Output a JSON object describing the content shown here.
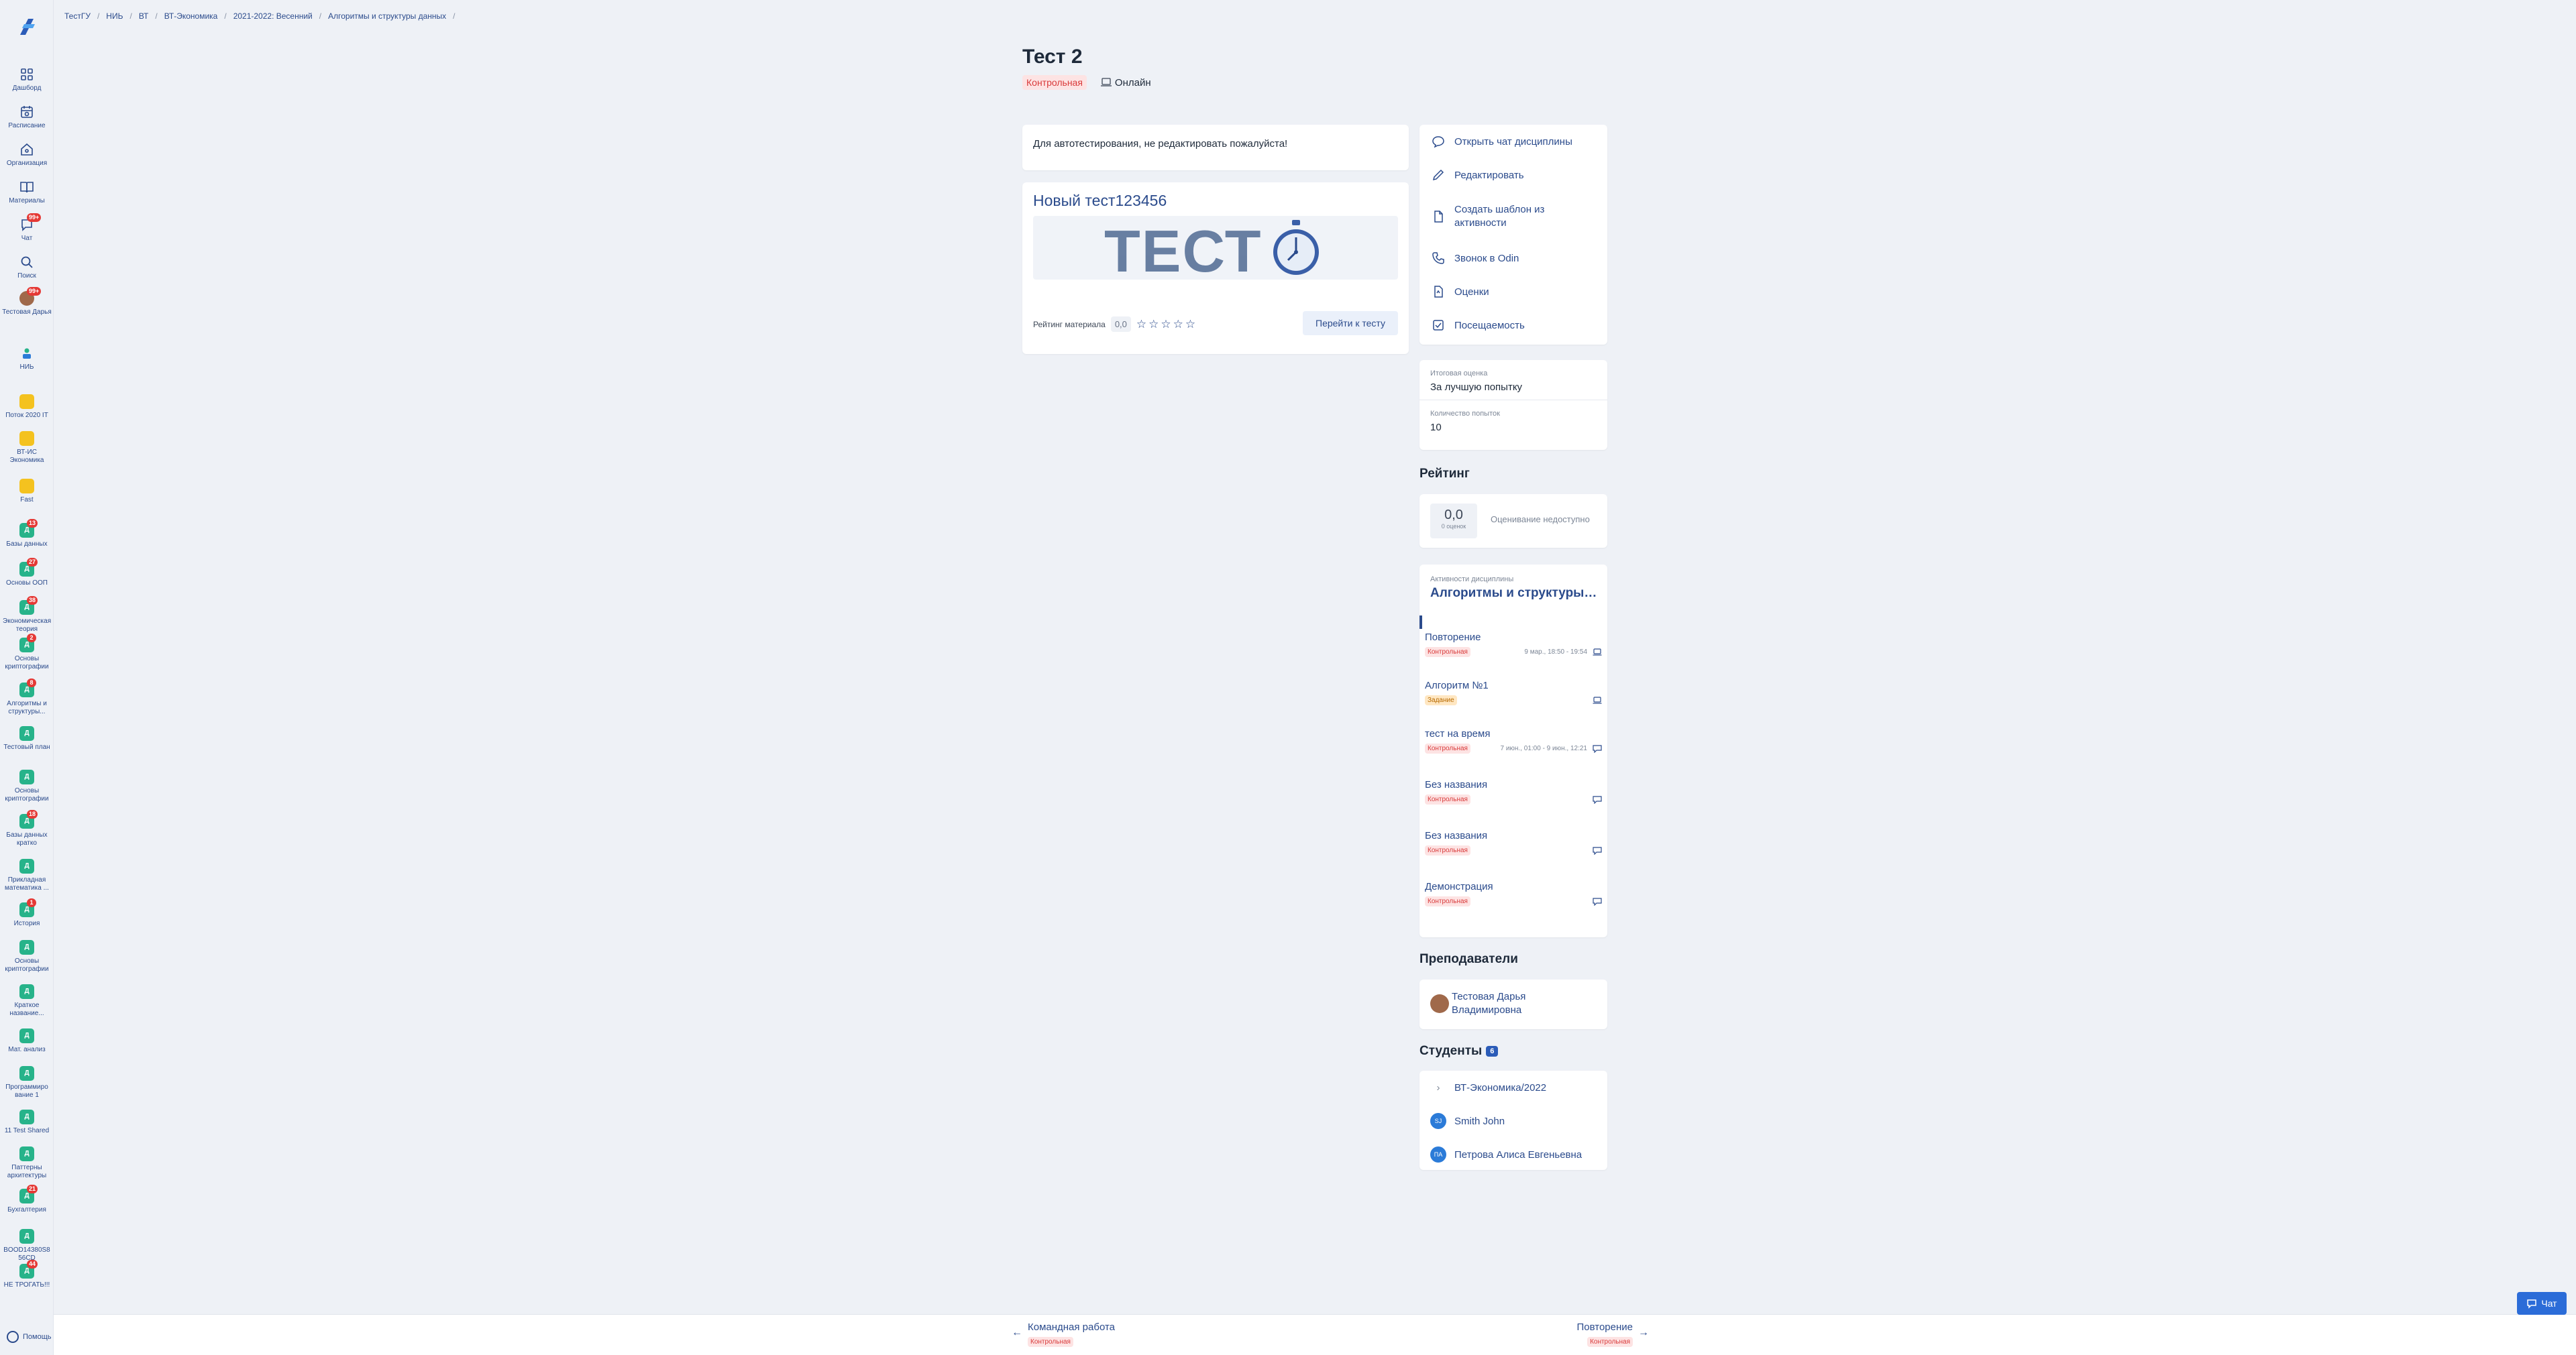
{
  "breadcrumbs": [
    "ТестГУ",
    "НИЬ",
    "ВТ",
    "ВТ-Экономика",
    "2021-2022: Весенний",
    "Алгоритмы и структуры данных"
  ],
  "sidebar": {
    "dashboard": "Дашборд",
    "schedule": "Расписание",
    "organization": "Организация",
    "materials": "Материалы",
    "chat": "Чат",
    "chat_badge": "99+",
    "search": "Поиск",
    "user": "Тестовая Дарья",
    "user_badge": "99+",
    "nii": "НИЬ",
    "groups": [
      {
        "label": "Поток 2020 IT",
        "badge": ""
      },
      {
        "label": "ВТ-ИС Экономика",
        "badge": ""
      },
      {
        "label": "Fast",
        "badge": ""
      },
      {
        "label": "Базы данных",
        "badge": "13"
      },
      {
        "label": "Основы ООП",
        "badge": "27"
      },
      {
        "label": "Экономическая теория",
        "badge": "38"
      },
      {
        "label": "Основы криптографии",
        "badge": "2"
      },
      {
        "label": "Алгоритмы и структуры...",
        "badge": "8"
      },
      {
        "label": "Тестовый план",
        "badge": ""
      },
      {
        "label": "Основы криптографии",
        "badge": ""
      },
      {
        "label": "Базы данных кратко",
        "badge": "18"
      },
      {
        "label": "Прикладная математика ...",
        "badge": ""
      },
      {
        "label": "История",
        "badge": "1"
      },
      {
        "label": "Основы криптографии",
        "badge": ""
      },
      {
        "label": "Краткое название...",
        "badge": ""
      },
      {
        "label": "Мат. анализ",
        "badge": ""
      },
      {
        "label": "Программиро вание 1",
        "badge": ""
      },
      {
        "label": "11 Test Shared",
        "badge": ""
      },
      {
        "label": "Паттерны архитектуры",
        "badge": ""
      },
      {
        "label": "Бухгалтерия",
        "badge": "21"
      },
      {
        "label": "BOOD14380S8 56CD",
        "badge": ""
      },
      {
        "label": "НЕ ТРОГАТЬ!!!",
        "badge": "44"
      }
    ],
    "help": "Помощь"
  },
  "page": {
    "title": "Тест 2",
    "type_tag": "Контрольная",
    "mode": "Онлайн",
    "description": "Для автотестирования, не редактировать пожалуйста!"
  },
  "test": {
    "name": "Новый тест123456",
    "banner_text": "ТЕСТ",
    "rating_label": "Рейтинг материала",
    "rating_value": "0,0",
    "go_button": "Перейти к тесту"
  },
  "actions": [
    "Открыть чат дисциплины",
    "Редактировать",
    "Создать шаблон из активности",
    "Звонок в Odin",
    "Оценки",
    "Посещаемость"
  ],
  "grade": {
    "final_label": "Итоговая оценка",
    "final_value": "За лучшую попытку",
    "attempts_label": "Количество попыток",
    "attempts_value": "10"
  },
  "rating": {
    "title": "Рейтинг",
    "value": "0,0",
    "sub": "0 оценок",
    "note": "Оценивание недоступно"
  },
  "activities": {
    "header_small": "Активности дисциплины",
    "header": "Алгоритмы и структуры данных",
    "items": [
      {
        "name": "Повторение",
        "tag": "Контрольная",
        "tag_kind": "red",
        "date": "9 мар., 18:50 - 19:54"
      },
      {
        "name": "Алгоритм №1",
        "tag": "Задание",
        "tag_kind": "orange",
        "date": ""
      },
      {
        "name": "тест на время",
        "tag": "Контрольная",
        "tag_kind": "red",
        "date": "7 июн., 01:00 - 9 июн., 12:21"
      },
      {
        "name": "Без названия",
        "tag": "Контрольная",
        "tag_kind": "red",
        "date": ""
      },
      {
        "name": "Без названия",
        "tag": "Контрольная",
        "tag_kind": "red",
        "date": ""
      },
      {
        "name": "Демонстрация",
        "tag": "Контрольная",
        "tag_kind": "red",
        "date": ""
      }
    ]
  },
  "teachers": {
    "title": "Преподаватели",
    "name": "Тестовая Дарья Владимировна"
  },
  "students": {
    "title": "Студенты",
    "count": "6",
    "group": "ВТ-Экономика/2022",
    "list": [
      {
        "initials": "SJ",
        "name": "Smith John"
      },
      {
        "initials": "ПА",
        "name": "Петрова Алиса Евгеньевна"
      }
    ]
  },
  "bottom_nav": {
    "prev_name": "Командная работа",
    "prev_tag": "Контрольная",
    "next_name": "Повторение",
    "next_tag": "Контрольная"
  },
  "chat_button": "Чат"
}
